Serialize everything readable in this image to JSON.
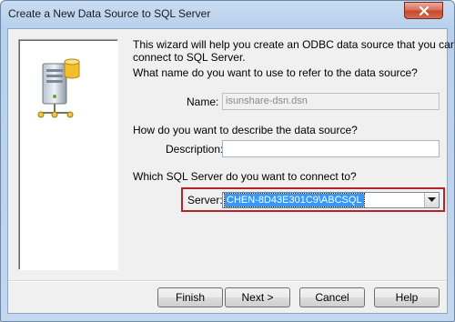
{
  "window": {
    "title": "Create a New Data Source to SQL Server"
  },
  "intro": {
    "line1": "This wizard will help you create an ODBC data source that you can use to",
    "line2": "connect to SQL Server."
  },
  "name_section": {
    "question": "What name do you want to use to refer to the data source?",
    "label": "Name:",
    "value": "isunshare-dsn.dsn"
  },
  "description_section": {
    "question": "How do you want to describe the data source?",
    "label": "Description:",
    "value": ""
  },
  "server_section": {
    "question": "Which SQL Server do you want to connect to?",
    "label": "Server:",
    "value": "CHEN-8D43E301C9\\ABCSQL"
  },
  "buttons": {
    "finish": "Finish",
    "next": "Next >",
    "cancel": "Cancel",
    "help": "Help"
  },
  "colors": {
    "highlight": "#3399ff",
    "annotation_box": "#b5232b"
  }
}
